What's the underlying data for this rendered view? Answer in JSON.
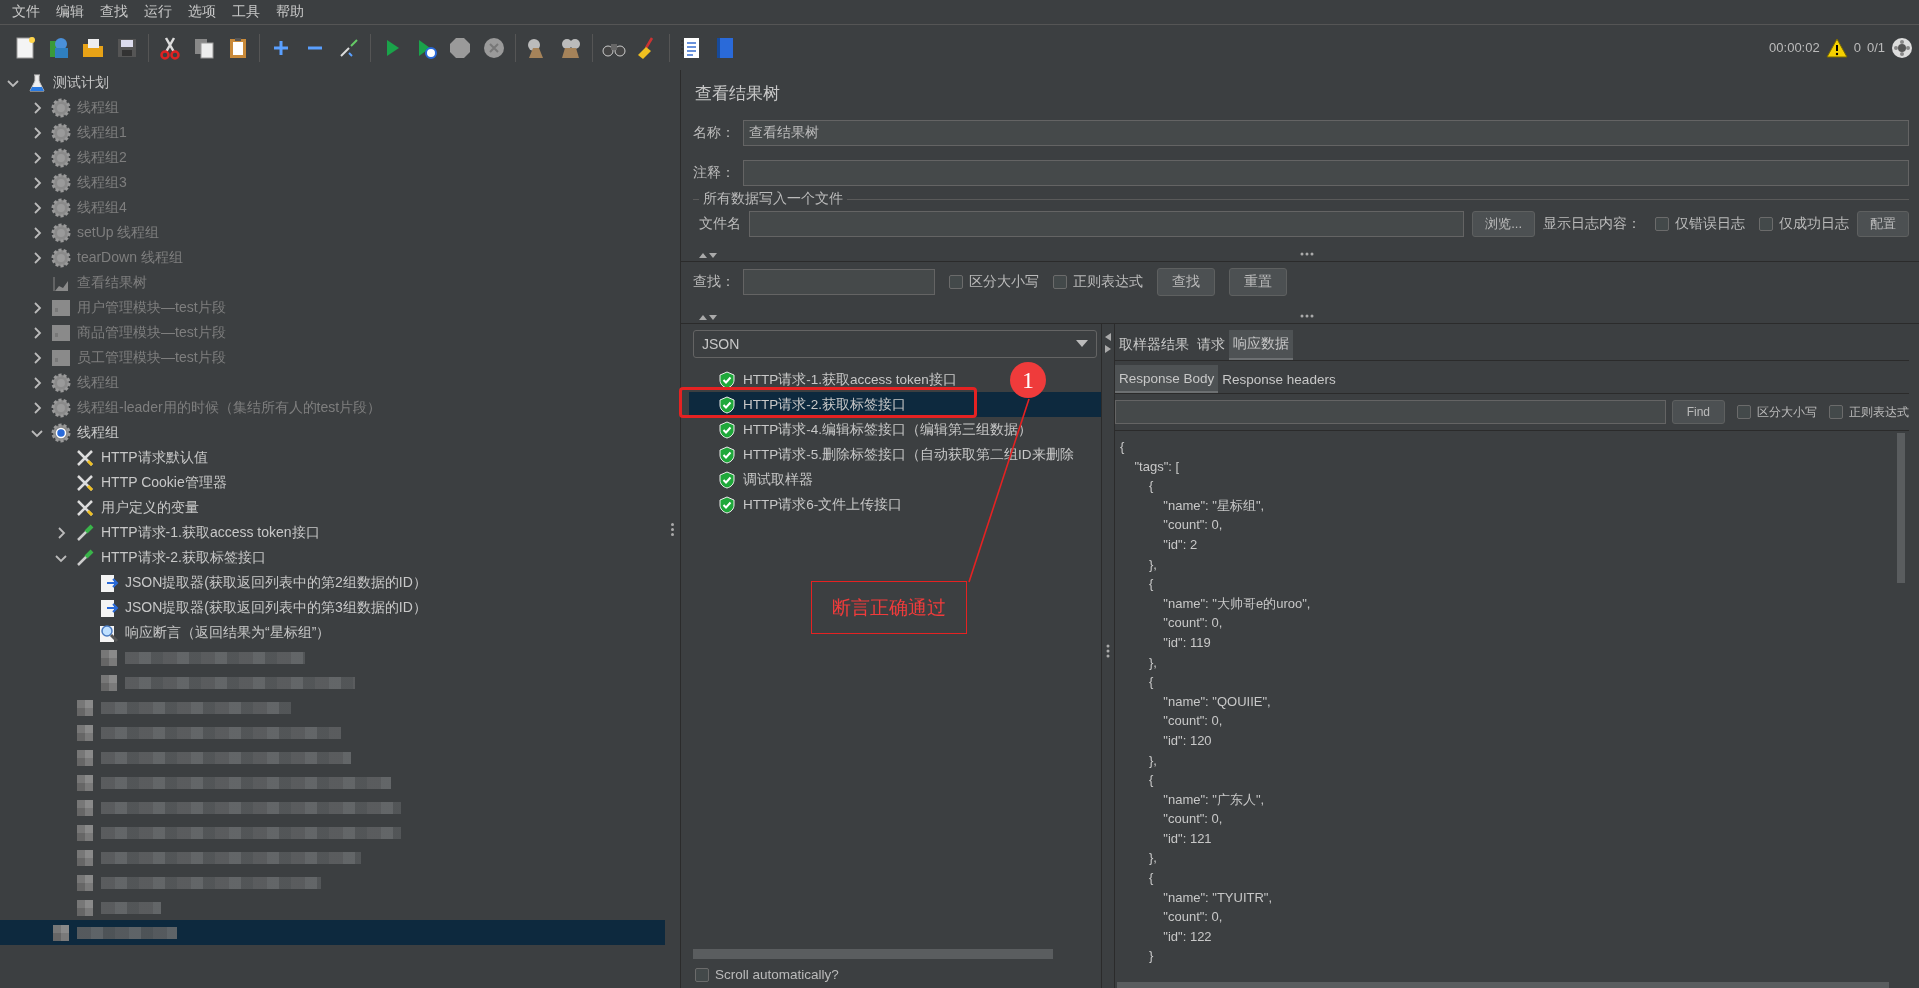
{
  "menu": [
    "文件",
    "编辑",
    "查找",
    "运行",
    "选项",
    "工具",
    "帮助"
  ],
  "status": {
    "timer": "00:00:02",
    "warnings": "0",
    "threads": "0/1"
  },
  "tree": [
    {
      "label": "测试计划",
      "kind": "plan",
      "expanded": true,
      "disabled": false,
      "selected": false,
      "children": [
        {
          "label": "线程组",
          "kind": "thread-group",
          "expanded": false,
          "disabled": true,
          "selected": false
        },
        {
          "label": "线程组1",
          "kind": "thread-group",
          "expanded": false,
          "disabled": true,
          "selected": false
        },
        {
          "label": "线程组2",
          "kind": "thread-group",
          "expanded": false,
          "disabled": true,
          "selected": false
        },
        {
          "label": "线程组3",
          "kind": "thread-group",
          "expanded": false,
          "disabled": true,
          "selected": false
        },
        {
          "label": "线程组4",
          "kind": "thread-group",
          "expanded": false,
          "disabled": true,
          "selected": false
        },
        {
          "label": "setUp 线程组",
          "kind": "thread-group",
          "expanded": false,
          "disabled": true,
          "selected": false
        },
        {
          "label": "tearDown 线程组",
          "kind": "thread-group",
          "expanded": false,
          "disabled": true,
          "selected": false
        },
        {
          "label": "查看结果树",
          "kind": "listener",
          "disabled": true,
          "selected": false
        },
        {
          "label": "用户管理模块—test片段",
          "kind": "fragment",
          "expanded": false,
          "disabled": true,
          "selected": false
        },
        {
          "label": "商品管理模块—test片段",
          "kind": "fragment",
          "expanded": false,
          "disabled": true,
          "selected": false
        },
        {
          "label": "员工管理模块—test片段",
          "kind": "fragment",
          "expanded": false,
          "disabled": true,
          "selected": false
        },
        {
          "label": "线程组",
          "kind": "thread-group",
          "expanded": false,
          "disabled": true,
          "selected": false
        },
        {
          "label": "线程组-leader用的时候（集结所有人的test片段）",
          "kind": "thread-group",
          "expanded": false,
          "disabled": true,
          "selected": false
        },
        {
          "label": "线程组",
          "kind": "thread-group",
          "expanded": true,
          "disabled": false,
          "selected": false,
          "children": [
            {
              "label": "HTTP请求默认值",
              "kind": "config",
              "disabled": false,
              "selected": false
            },
            {
              "label": "HTTP Cookie管理器",
              "kind": "config",
              "disabled": false,
              "selected": false
            },
            {
              "label": "用户定义的变量",
              "kind": "config",
              "disabled": false,
              "selected": false
            },
            {
              "label": "HTTP请求-1.获取access token接口",
              "kind": "sampler",
              "expanded": false,
              "disabled": false,
              "selected": false
            },
            {
              "label": "HTTP请求-2.获取标签接口",
              "kind": "sampler",
              "expanded": true,
              "disabled": false,
              "selected": false,
              "children": [
                {
                  "label": "JSON提取器(获取返回列表中的第2组数据的ID）",
                  "kind": "extractor",
                  "disabled": false,
                  "selected": false
                },
                {
                  "label": "JSON提取器(获取返回列表中的第3组数据的ID）",
                  "kind": "extractor",
                  "disabled": false,
                  "selected": false
                },
                {
                  "label": "响应断言（返回结果为“星标组”）",
                  "kind": "assertion",
                  "disabled": false,
                  "selected": false
                },
                {
                  "kind": "redacted",
                  "selected": false
                },
                {
                  "kind": "redacted",
                  "selected": false
                }
              ]
            },
            {
              "kind": "redacted",
              "selected": false
            },
            {
              "kind": "redacted",
              "selected": false
            },
            {
              "kind": "redacted",
              "selected": false
            },
            {
              "kind": "redacted",
              "selected": false
            },
            {
              "kind": "redacted",
              "selected": false
            },
            {
              "kind": "redacted",
              "selected": false
            },
            {
              "kind": "redacted",
              "selected": false
            },
            {
              "kind": "redacted",
              "selected": false
            },
            {
              "kind": "redacted",
              "selected": false
            }
          ]
        },
        {
          "kind": "redacted",
          "selected": true
        }
      ]
    }
  ],
  "panel": {
    "title": "查看结果树",
    "name_label": "名称：",
    "name_value": "查看结果树",
    "comment_label": "注释：",
    "file_section": {
      "legend": "所有数据写入一个文件",
      "file_label": "文件名",
      "browse": "浏览...",
      "log_label": "显示日志内容：",
      "options": [
        {
          "label": "仅错误日志",
          "checked": false
        },
        {
          "label": "仅成功日志",
          "checked": false
        }
      ],
      "configure": "配置"
    },
    "search": {
      "label": "查找：",
      "options": [
        {
          "label": "区分大小写",
          "checked": false
        },
        {
          "label": "正则表达式",
          "checked": false
        }
      ],
      "find": "查找",
      "reset": "重置"
    }
  },
  "results": {
    "renderer": "JSON",
    "items": [
      {
        "label": "HTTP请求-1.获取access token接口",
        "selected": false
      },
      {
        "label": "HTTP请求-2.获取标签接口",
        "selected": true
      },
      {
        "label": "HTTP请求-4.编辑标签接口（编辑第三组数据）",
        "selected": false
      },
      {
        "label": "HTTP请求-5.删除标签接口（自动获取第二组ID来删除",
        "selected": false
      },
      {
        "label": "调试取样器",
        "selected": false
      },
      {
        "label": "HTTP请求6-文件上传接口",
        "selected": false
      }
    ],
    "scroll_auto": {
      "label": "Scroll automatically?",
      "checked": false
    }
  },
  "detail": {
    "tabs": [
      {
        "label": "取样器结果",
        "selected": false
      },
      {
        "label": "请求",
        "selected": false
      },
      {
        "label": "响应数据",
        "selected": true
      }
    ],
    "subtabs": [
      {
        "label": "Response Body",
        "selected": true
      },
      {
        "label": "Response headers",
        "selected": false
      }
    ],
    "find": "Find",
    "options": [
      {
        "label": "区分大小写",
        "checked": false
      },
      {
        "label": "正则表达式",
        "checked": false
      }
    ],
    "body_lines": [
      "{",
      "    \"tags\": [",
      "        {",
      "            \"name\": \"星标组\",",
      "            \"count\": 0,",
      "            \"id\": 2",
      "        },",
      "        {",
      "            \"name\": \"大帅哥e的uroo\",",
      "            \"count\": 0,",
      "            \"id\": 119",
      "        },",
      "        {",
      "            \"name\": \"QOUIIE\",",
      "            \"count\": 0,",
      "            \"id\": 120",
      "        },",
      "        {",
      "            \"name\": \"广东人\",",
      "            \"count\": 0,",
      "            \"id\": 121",
      "        },",
      "        {",
      "            \"name\": \"TYUITR\",",
      "            \"count\": 0,",
      "            \"id\": 122",
      "        }"
    ]
  },
  "annotation": {
    "badge": "1",
    "note": "断言正确通过"
  }
}
